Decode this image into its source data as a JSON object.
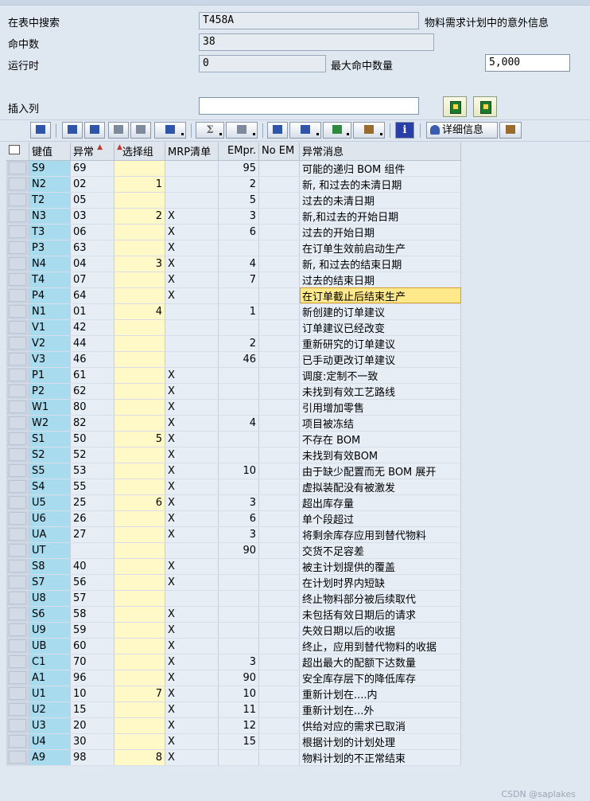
{
  "header": {
    "search_label": "在表中搜索",
    "search_value": "T458A",
    "description": "物料需求计划中的意外信息",
    "hits_label": "命中数",
    "hits_value": "38",
    "runtime_label": "运行时",
    "runtime_value": "0",
    "max_hits_label": "最大命中数量",
    "max_hits_value": "5,000",
    "insert_col_label": "插入列",
    "insert_col_value": ""
  },
  "toolbar": {
    "detail_label": "详细信息",
    "info_label": "i",
    "sum_label": "Σ"
  },
  "table": {
    "columns": [
      "键值",
      "异常",
      "选择组",
      "MRP清单",
      "EMpr.",
      "No EM",
      "异常消息"
    ],
    "rows": [
      {
        "key": "S9",
        "exc": "69",
        "grp": "",
        "mrp": "",
        "empr": "95",
        "noem": "",
        "msg": "可能的递归 BOM 组件",
        "sep": false
      },
      {
        "key": "N2",
        "exc": "02",
        "grp": "1",
        "mrp": "",
        "empr": "2",
        "noem": "",
        "msg": "新, 和过去的未清日期",
        "sep": true
      },
      {
        "key": "T2",
        "exc": "05",
        "grp": "",
        "mrp": "",
        "empr": "5",
        "noem": "",
        "msg": "过去的未清日期",
        "sep": false
      },
      {
        "key": "N3",
        "exc": "03",
        "grp": "2",
        "mrp": "X",
        "empr": "3",
        "noem": "",
        "msg": "新,和过去的开始日期",
        "sep": true
      },
      {
        "key": "T3",
        "exc": "06",
        "grp": "",
        "mrp": "X",
        "empr": "6",
        "noem": "",
        "msg": "过去的开始日期",
        "sep": false
      },
      {
        "key": "P3",
        "exc": "63",
        "grp": "",
        "mrp": "X",
        "empr": "",
        "noem": "",
        "msg": "在订单生效前启动生产",
        "sep": false
      },
      {
        "key": "N4",
        "exc": "04",
        "grp": "3",
        "mrp": "X",
        "empr": "4",
        "noem": "",
        "msg": "新, 和过去的结束日期",
        "sep": true
      },
      {
        "key": "T4",
        "exc": "07",
        "grp": "",
        "mrp": "X",
        "empr": "7",
        "noem": "",
        "msg": "过去的结束日期",
        "sep": false
      },
      {
        "key": "P4",
        "exc": "64",
        "grp": "",
        "mrp": "X",
        "empr": "",
        "noem": "",
        "msg": "在订单截止后结束生产",
        "sep": false,
        "hl": true
      },
      {
        "key": "N1",
        "exc": "01",
        "grp": "4",
        "mrp": "",
        "empr": "1",
        "noem": "",
        "msg": "新创建的订单建议",
        "sep": true
      },
      {
        "key": "V1",
        "exc": "42",
        "grp": "",
        "mrp": "",
        "empr": "",
        "noem": "",
        "msg": "订单建议已经改变",
        "sep": false
      },
      {
        "key": "V2",
        "exc": "44",
        "grp": "",
        "mrp": "",
        "empr": "2",
        "noem": "",
        "msg": "重新研究的订单建议",
        "sep": false
      },
      {
        "key": "V3",
        "exc": "46",
        "grp": "",
        "mrp": "",
        "empr": "46",
        "noem": "",
        "msg": "已手动更改订单建议",
        "sep": false
      },
      {
        "key": "P1",
        "exc": "61",
        "grp": "",
        "mrp": "X",
        "empr": "",
        "noem": "",
        "msg": "调度:定制不一致",
        "sep": false
      },
      {
        "key": "P2",
        "exc": "62",
        "grp": "",
        "mrp": "X",
        "empr": "",
        "noem": "",
        "msg": "未找到有效工艺路线",
        "sep": false
      },
      {
        "key": "W1",
        "exc": "80",
        "grp": "",
        "mrp": "X",
        "empr": "",
        "noem": "",
        "msg": "引用增加零售",
        "sep": false
      },
      {
        "key": "W2",
        "exc": "82",
        "grp": "",
        "mrp": "X",
        "empr": "4",
        "noem": "",
        "msg": "项目被冻结",
        "sep": false
      },
      {
        "key": "S1",
        "exc": "50",
        "grp": "5",
        "mrp": "X",
        "empr": "",
        "noem": "",
        "msg": "不存在 BOM",
        "sep": true
      },
      {
        "key": "S2",
        "exc": "52",
        "grp": "",
        "mrp": "X",
        "empr": "",
        "noem": "",
        "msg": "未找到有效BOM",
        "sep": false
      },
      {
        "key": "S5",
        "exc": "53",
        "grp": "",
        "mrp": "X",
        "empr": "10",
        "noem": "",
        "msg": "由于缺少配置而无 BOM 展开",
        "sep": false
      },
      {
        "key": "S4",
        "exc": "55",
        "grp": "",
        "mrp": "X",
        "empr": "",
        "noem": "",
        "msg": "虚拟装配没有被激发",
        "sep": false
      },
      {
        "key": "U5",
        "exc": "25",
        "grp": "6",
        "mrp": "X",
        "empr": "3",
        "noem": "",
        "msg": "超出库存量",
        "sep": true
      },
      {
        "key": "U6",
        "exc": "26",
        "grp": "",
        "mrp": "X",
        "empr": "6",
        "noem": "",
        "msg": "单个段超过",
        "sep": false
      },
      {
        "key": "UA",
        "exc": "27",
        "grp": "",
        "mrp": "X",
        "empr": "3",
        "noem": "",
        "msg": "将剩余库存应用到替代物料",
        "sep": false
      },
      {
        "key": "UT",
        "exc": "",
        "grp": "",
        "mrp": "",
        "empr": "90",
        "noem": "",
        "msg": "交货不足容差",
        "sep": false
      },
      {
        "key": "S8",
        "exc": "40",
        "grp": "",
        "mrp": "X",
        "empr": "",
        "noem": "",
        "msg": "被主计划提供的覆盖",
        "sep": false
      },
      {
        "key": "S7",
        "exc": "56",
        "grp": "",
        "mrp": "X",
        "empr": "",
        "noem": "",
        "msg": "在计划时界内短缺",
        "sep": false
      },
      {
        "key": "U8",
        "exc": "57",
        "grp": "",
        "mrp": "",
        "empr": "",
        "noem": "",
        "msg": "终止物料部分被后续取代",
        "sep": false
      },
      {
        "key": "S6",
        "exc": "58",
        "grp": "",
        "mrp": "X",
        "empr": "",
        "noem": "",
        "msg": "未包括有效日期后的请求",
        "sep": false
      },
      {
        "key": "U9",
        "exc": "59",
        "grp": "",
        "mrp": "X",
        "empr": "",
        "noem": "",
        "msg": "失效日期以后的收据",
        "sep": false
      },
      {
        "key": "UB",
        "exc": "60",
        "grp": "",
        "mrp": "X",
        "empr": "",
        "noem": "",
        "msg": "终止，应用到替代物料的收据",
        "sep": false
      },
      {
        "key": "C1",
        "exc": "70",
        "grp": "",
        "mrp": "X",
        "empr": "3",
        "noem": "",
        "msg": "超出最大的配额下达数量",
        "sep": false
      },
      {
        "key": "A1",
        "exc": "96",
        "grp": "",
        "mrp": "X",
        "empr": "90",
        "noem": "",
        "msg": "安全库存层下的降低库存",
        "sep": false
      },
      {
        "key": "U1",
        "exc": "10",
        "grp": "7",
        "mrp": "X",
        "empr": "10",
        "noem": "",
        "msg": "重新计划在....内",
        "sep": true
      },
      {
        "key": "U2",
        "exc": "15",
        "grp": "",
        "mrp": "X",
        "empr": "11",
        "noem": "",
        "msg": "重新计划在...外",
        "sep": false
      },
      {
        "key": "U3",
        "exc": "20",
        "grp": "",
        "mrp": "X",
        "empr": "12",
        "noem": "",
        "msg": "供给对应的需求已取消",
        "sep": false
      },
      {
        "key": "U4",
        "exc": "30",
        "grp": "",
        "mrp": "X",
        "empr": "15",
        "noem": "",
        "msg": "根据计划的计划处理",
        "sep": false
      },
      {
        "key": "A9",
        "exc": "98",
        "grp": "8",
        "mrp": "X",
        "empr": "",
        "noem": "",
        "msg": "物料计划的不正常结束",
        "sep": true
      }
    ]
  },
  "watermark": "CSDN @saplakes",
  "colors": {
    "background": "#dfe7f1",
    "key_column": "#a9dbee",
    "group_column": "#fff9c7",
    "highlight": "#ffe98a"
  }
}
